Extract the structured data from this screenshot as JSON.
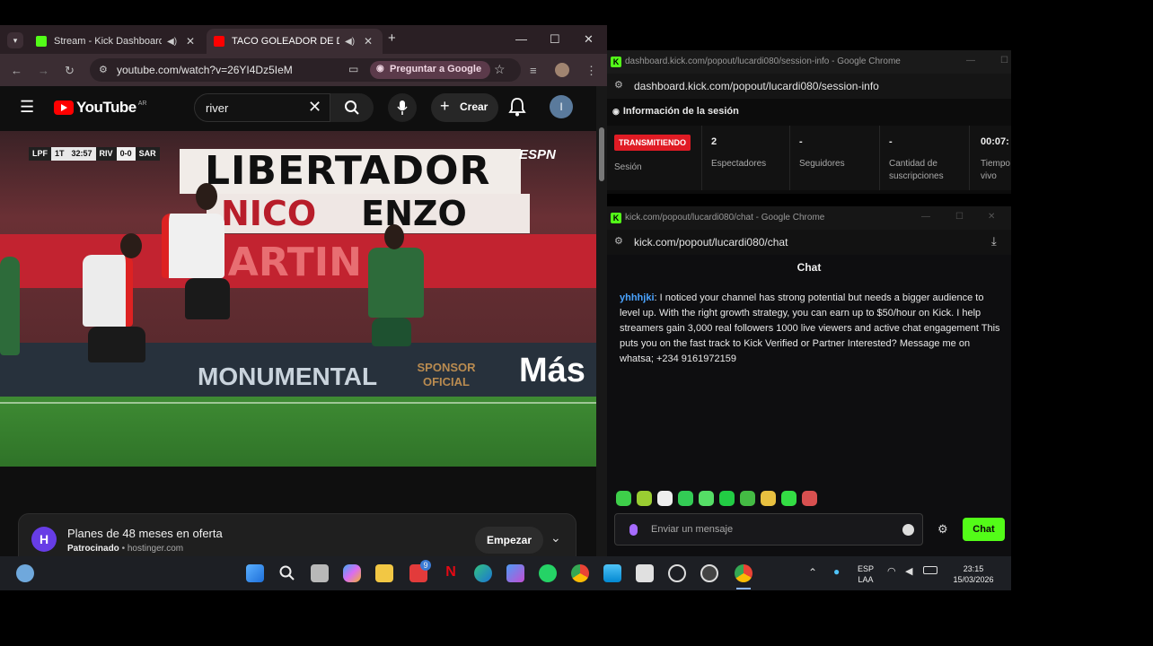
{
  "left_window": {
    "tabs": [
      {
        "label": "Stream - Kick Dashboard",
        "favicon_color": "#53fc18"
      },
      {
        "label": "TACO GOLEADOR DE DRU",
        "favicon_color": "#ff0000"
      }
    ],
    "window_controls": {
      "minimize": "—",
      "maximize": "☐",
      "close": "✕"
    },
    "new_tab": "+",
    "url": "youtube.com/watch?v=26YI4Dz5IeM",
    "ask_google": "Preguntar a Google"
  },
  "youtube": {
    "logo_text": "YouTube",
    "region": "AR",
    "search_value": "river",
    "create_label": "Crear",
    "avatar_letter": "I",
    "video": {
      "scorebug": {
        "league": "LPF",
        "period": "1T",
        "clock": "32:57",
        "home": "RIV",
        "score": "0-0",
        "away": "SAR"
      },
      "broadcaster": "ESPN",
      "banner_top": "LIBERTADOR",
      "banner_mid_left": "NICO",
      "banner_mid_right": "ENZO",
      "banner_red": "MARTIN",
      "ad_board_text": "MONUMENTAL",
      "sponsor": "SPONSOR OFICIAL",
      "mas": "Más"
    },
    "ad": {
      "logo": "H",
      "title": "Planes de 48 meses en oferta",
      "sponsored": "Patrocinado",
      "domain": "hostinger.com",
      "cta": "Empezar"
    }
  },
  "session_window": {
    "title_bar": "dashboard.kick.com/popout/lucardi080/session-info - Google Chrome",
    "url": "dashboard.kick.com/popout/lucardi080/session-info",
    "heading": "Información de la sesión",
    "stats": [
      {
        "value": "TRANSMITIENDO",
        "label": "Sesión"
      },
      {
        "value": "2",
        "label": "Espectadores"
      },
      {
        "value": "-",
        "label": "Seguidores"
      },
      {
        "value": "-",
        "label": "Cantidad de suscripciones"
      },
      {
        "value": "00:07:",
        "label": "Tiempo vivo"
      }
    ]
  },
  "chat_window": {
    "title_bar": "kick.com/popout/lucardi080/chat - Google Chrome",
    "url": "kick.com/popout/lucardi080/chat",
    "header": "Chat",
    "message": {
      "user": "yhhhjki",
      "text": ": I noticed your channel has strong potential but needs a bigger audience to level up. With the right growth strategy, you can earn up to $50/hour on Kick. I help streamers gain 3,000 real followers 1000 live viewers and active chat engagement This puts you on the fast track to Kick Verified or Partner Interested? Message me on whatsa; +234 9161972159"
    },
    "emote_colors": [
      "#3ecf4a",
      "#9acd32",
      "#eeeeee",
      "#33cc55",
      "#55dd66",
      "#22cc44",
      "#44bb44",
      "#e8c040",
      "#33dd44",
      "#d85050"
    ],
    "input_placeholder": "Enviar un mensaje",
    "send_label": "Chat",
    "accent": "#53fc18"
  },
  "taskbar": {
    "lang_top": "ESP",
    "lang_bottom": "LAA",
    "time": "23:15",
    "date": "15/03/2026",
    "badge": "9"
  }
}
